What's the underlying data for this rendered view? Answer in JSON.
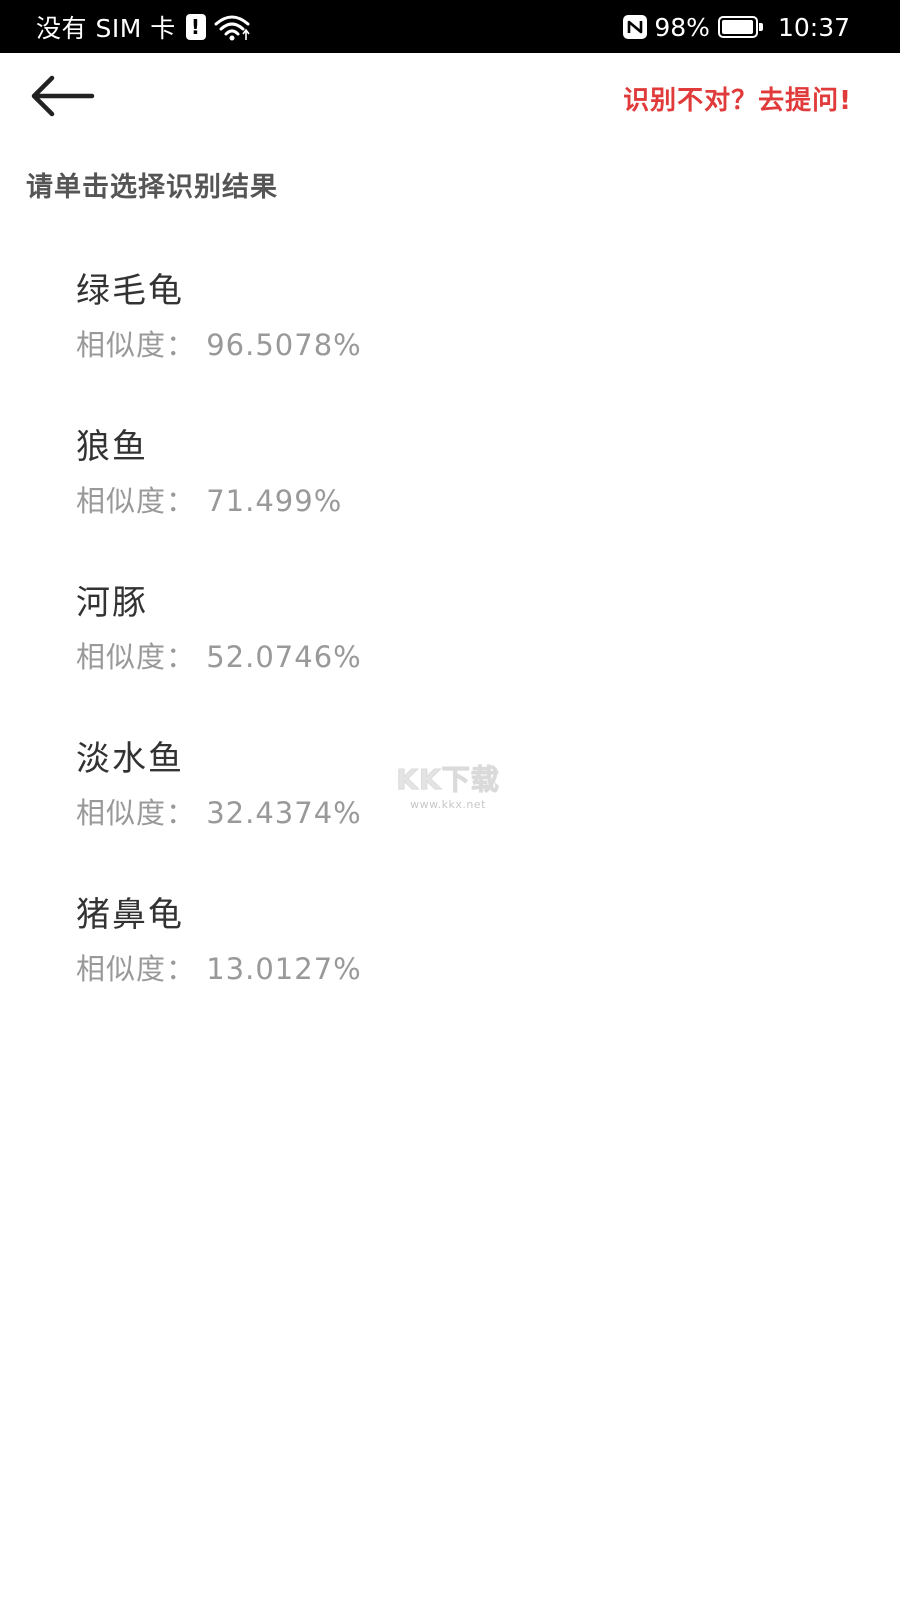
{
  "status_bar": {
    "carrier": "没有 SIM 卡",
    "battery_percent": "98%",
    "battery_level": 0.98,
    "time": "10:37",
    "icons": [
      "sim-alert-icon",
      "wifi-icon",
      "nfc-icon",
      "battery-icon"
    ]
  },
  "header": {
    "back_icon": "arrow-left-icon",
    "help_link": "识别不对？去提问!",
    "help_color": "#e03a3a"
  },
  "instruction": "请单击选择识别结果",
  "results": [
    {
      "name": "绿毛龟",
      "score": "相似度：  96.5078%"
    },
    {
      "name": "狼鱼",
      "score": "相似度：  71.499%"
    },
    {
      "name": "河豚",
      "score": "相似度：  52.0746%"
    },
    {
      "name": "淡水鱼",
      "score": "相似度：  32.4374%"
    },
    {
      "name": "猪鼻龟",
      "score": "相似度：  13.0127%"
    }
  ],
  "watermark": {
    "logo": "KK下载",
    "url": "www.kkx.net"
  }
}
